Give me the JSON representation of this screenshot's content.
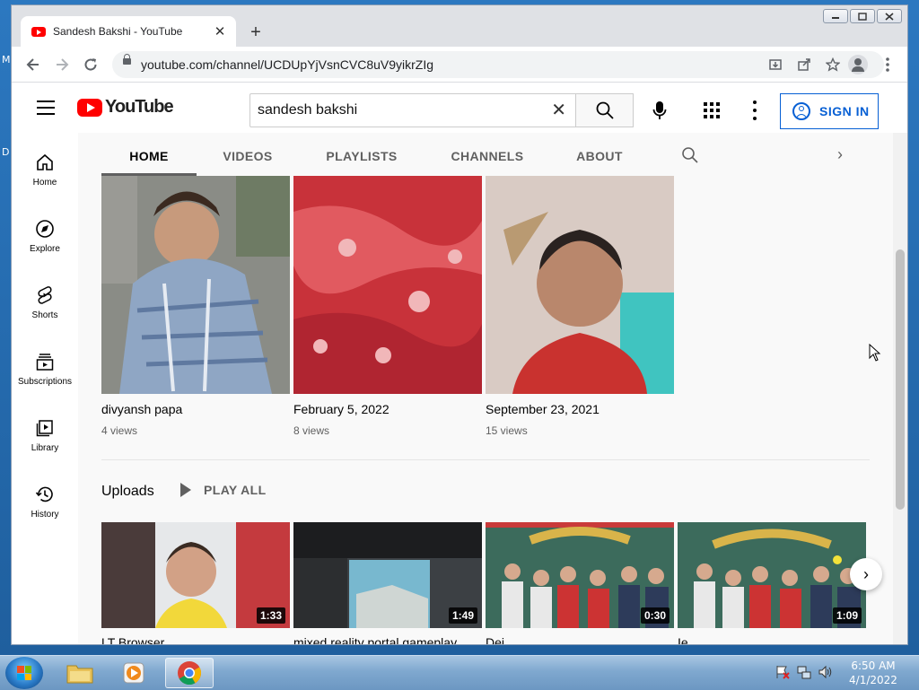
{
  "desktop": {
    "left_letters": [
      "M",
      "D"
    ]
  },
  "browser": {
    "tab": {
      "title": "Sandesh Bakshi - YouTube",
      "close": "✕"
    },
    "new_tab": "+",
    "window_controls": {
      "minimize": "▭",
      "maximize": "□",
      "close": "✕"
    },
    "toolbar": {
      "back": "←",
      "forward": "→",
      "reload": "↻",
      "url": "youtube.com/channel/UCDUpYjVsnCVC8uV9yikrZIg"
    }
  },
  "youtube": {
    "logo_text": "YouTube",
    "search": {
      "value": "sandesh bakshi",
      "clear": "✕"
    },
    "sign_in": "SIGN IN",
    "guide": [
      {
        "label": "Home",
        "icon": "home-icon"
      },
      {
        "label": "Explore",
        "icon": "compass-icon"
      },
      {
        "label": "Shorts",
        "icon": "shorts-icon"
      },
      {
        "label": "Subscriptions",
        "icon": "subscriptions-icon"
      },
      {
        "label": "Library",
        "icon": "library-icon"
      },
      {
        "label": "History",
        "icon": "history-icon"
      }
    ],
    "channel_tabs": [
      "HOME",
      "VIDEOS",
      "PLAYLISTS",
      "CHANNELS",
      "ABOUT"
    ],
    "tab_next": "›",
    "top_videos": [
      {
        "title": "divyansh papa",
        "views": "4 views"
      },
      {
        "title": "February 5, 2022",
        "views": "8 views"
      },
      {
        "title": "September 23, 2021",
        "views": "15 views"
      }
    ],
    "uploads": {
      "title": "Uploads",
      "play_all": "PLAY ALL",
      "next": "›",
      "videos": [
        {
          "title": "LT Browser",
          "duration": "1:33"
        },
        {
          "title": "mixed reality portal gameplay",
          "duration": "1:49"
        },
        {
          "title": "Dei",
          "duration": "0:30"
        },
        {
          "title": "Ie",
          "duration": "1:09"
        }
      ]
    }
  },
  "taskbar": {
    "time": "6:50 AM",
    "date": "4/1/2022"
  },
  "colors": {
    "yt_red": "#ff0000",
    "link_blue": "#065fd4"
  }
}
